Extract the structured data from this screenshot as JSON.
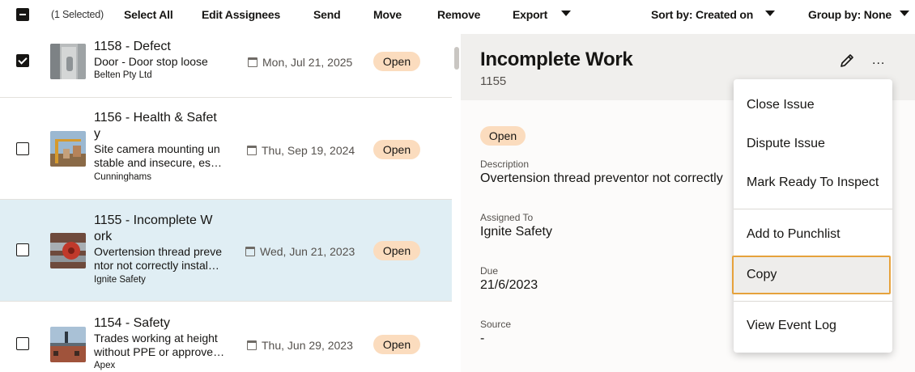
{
  "toolbar": {
    "selected_count": "(1 Selected)",
    "select_all": "Select All",
    "edit_assignees": "Edit Assignees",
    "send": "Send",
    "move": "Move",
    "remove": "Remove",
    "export": "Export",
    "sort_by": "Sort by: Created on",
    "group_by": "Group by: None"
  },
  "list": {
    "items": [
      {
        "title": "1158 - Defect",
        "desc": "Door - Door stop loose",
        "company": "Belten Pty Ltd",
        "date": "Mon, Jul 21, 2025",
        "status": "Open",
        "checked": true,
        "thumb_icon": "door-photo"
      },
      {
        "title": "1156 - Health & Safet y",
        "desc": "Site camera mounting un stable and insecure, es…",
        "company": "Cunninghams",
        "date": "Thu, Sep 19, 2024",
        "status": "Open",
        "checked": false,
        "thumb_icon": "crane-photo"
      },
      {
        "title": "1155 - Incomplete W ork",
        "desc": "Overtension thread preve ntor not correctly instal…",
        "company": "Ignite Safety",
        "date": "Wed, Jun 21, 2023",
        "status": "Open",
        "checked": false,
        "thumb_icon": "valve-photo"
      },
      {
        "title": "1154 - Safety",
        "desc": "Trades working at height without PPE or approve…",
        "company": "Apex",
        "date": "Thu, Jun 29, 2023",
        "status": "Open",
        "checked": false,
        "thumb_icon": "building-photo"
      }
    ]
  },
  "detail": {
    "title": "Incomplete Work",
    "id": "1155",
    "status": "Open",
    "description_label": "Description",
    "description_value": "Overtension thread preventor not correctly",
    "assigned_label": "Assigned To",
    "assigned_value": "Ignite Safety",
    "due_label": "Due",
    "due_value": "21/6/2023",
    "source_label": "Source",
    "source_value": "-",
    "more_label": "..."
  },
  "menu": {
    "items": [
      "Close Issue",
      "Dispute Issue",
      "Mark Ready To Inspect",
      "Add to Punchlist",
      "Copy",
      "View Event Log"
    ]
  },
  "colors": {
    "selected_row": "#e0eef4",
    "badge": "#fbdcbe",
    "focus_ring": "#e6a23c",
    "detail_header": "#f0efed"
  }
}
